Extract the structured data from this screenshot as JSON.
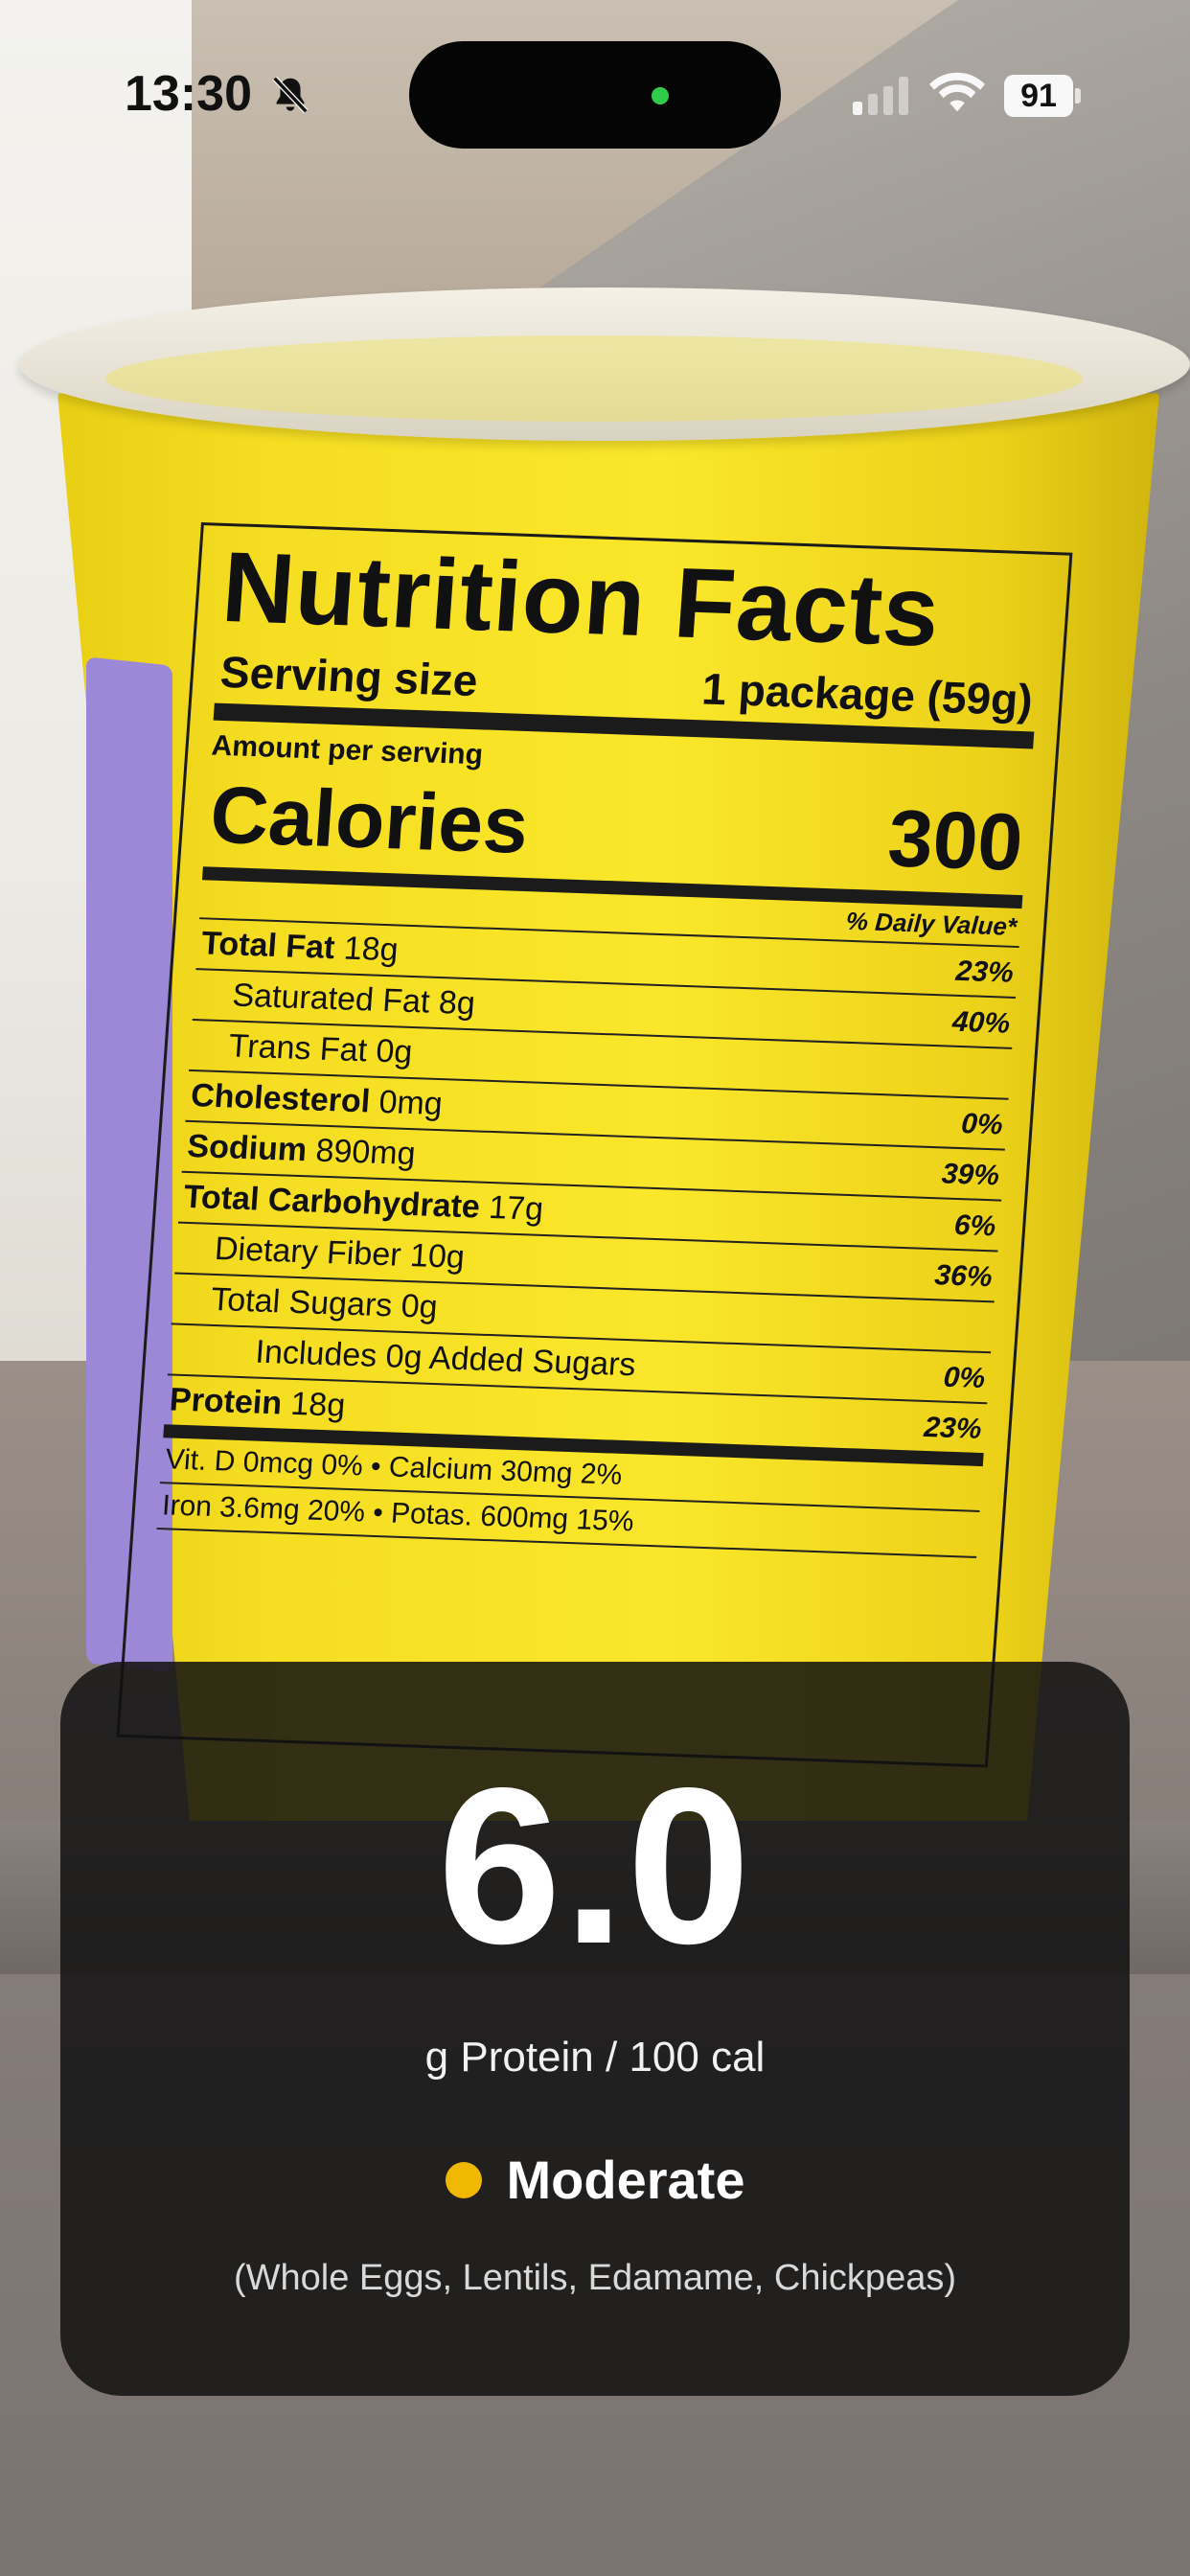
{
  "status_bar": {
    "time": "13:30",
    "battery": "91"
  },
  "nutrition_label": {
    "title": "Nutrition Facts",
    "serving_label": "Serving size",
    "serving_value": "1 package (59g)",
    "amount_per_serving": "Amount per serving",
    "calories_label": "Calories",
    "calories_value": "300",
    "daily_value_header": "% Daily Value*",
    "rows": [
      {
        "label": "Total Fat",
        "amount": "18g",
        "pct": "23%"
      },
      {
        "label": "Saturated Fat",
        "amount": "8g",
        "pct": "40%"
      },
      {
        "label": "Trans Fat",
        "amount": "0g",
        "pct": ""
      },
      {
        "label": "Cholesterol",
        "amount": "0mg",
        "pct": "0%"
      },
      {
        "label": "Sodium",
        "amount": "890mg",
        "pct": "39%"
      },
      {
        "label": "Total Carbohydrate",
        "amount": "17g",
        "pct": "6%"
      },
      {
        "label": "Dietary Fiber",
        "amount": "10g",
        "pct": "36%"
      },
      {
        "label": "Total Sugars",
        "amount": "0g",
        "pct": ""
      },
      {
        "label": "Includes 0g Added Sugars",
        "amount": "",
        "pct": "0%"
      },
      {
        "label": "Protein",
        "amount": "18g",
        "pct": "23%"
      }
    ],
    "vitamins": [
      "Vit. D 0mcg 0%  •  Calcium 30mg 2%",
      "Iron 3.6mg 20%  •  Potas. 600mg 15%"
    ]
  },
  "result": {
    "score": "6.0",
    "unit": "g Protein / 100 cal",
    "rating": "Moderate",
    "rating_color": "#f0b800",
    "examples": "(Whole Eggs, Lentils, Edamame, Chickpeas)"
  }
}
